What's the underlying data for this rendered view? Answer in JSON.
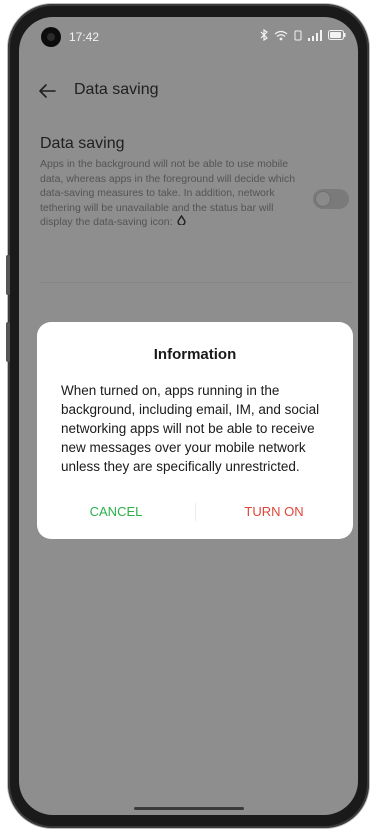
{
  "status_bar": {
    "time": "17:42",
    "icons": [
      "bluetooth-icon",
      "wifi-icon",
      "volte-icon",
      "signal-icon",
      "battery-icon"
    ]
  },
  "header": {
    "back_icon": "back-arrow-icon",
    "title": "Data saving"
  },
  "setting": {
    "title": "Data saving",
    "description": "Apps in the background will not be able to use mobile data, whereas apps in the foreground will decide which data-saving measures to take. In addition, network tethering will be unavailable and the status bar will display the data-saving icon:",
    "toggle_state": "off"
  },
  "dialog": {
    "title": "Information",
    "message": "When turned on, apps running in the background, including email, IM, and social networking apps will not be able to receive new messages over your mobile network unless they are specifically unrestricted.",
    "cancel_label": "CANCEL",
    "confirm_label": "TURN ON"
  },
  "colors": {
    "cancel": "#2bb04a",
    "confirm": "#e0473a",
    "scrim": "#8e8e8e"
  }
}
